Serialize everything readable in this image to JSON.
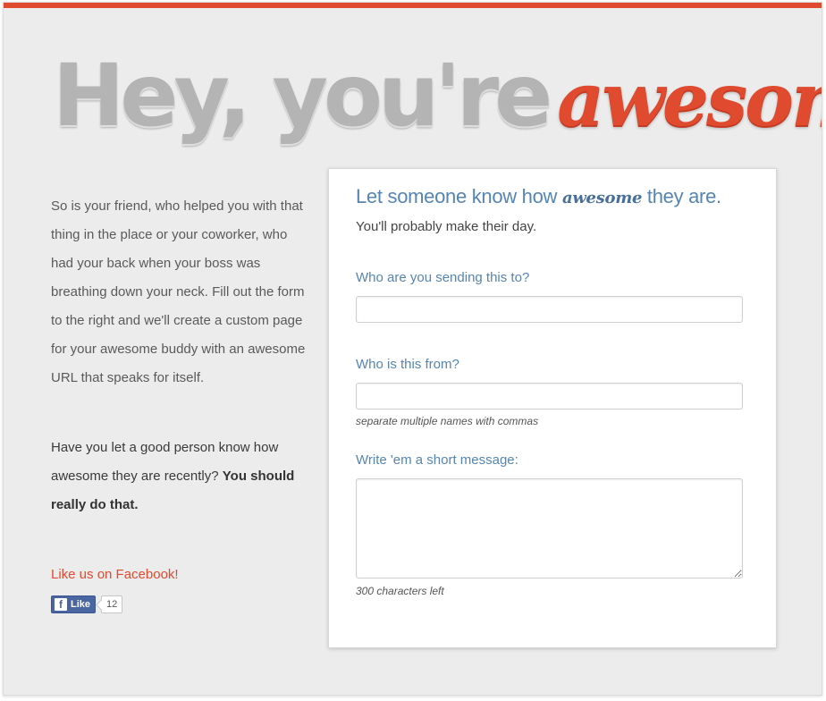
{
  "header": {
    "headline_plain": "Hey, you're",
    "headline_script": "awesome"
  },
  "intro": {
    "paragraph": "So is your friend, who helped you with that thing in the place or your coworker, who had your back when your boss was breathing down your neck. Fill out the form to the right and we'll create a custom page for your awesome buddy with an awesome URL that speaks for itself.",
    "question": "Have you let a good person know how awesome they are recently?",
    "question_bold": "You should really do that."
  },
  "social": {
    "facebook_link": "Like us on Facebook!",
    "like_logo": "f",
    "like_label": "Like",
    "like_count": "12"
  },
  "form": {
    "title_before": "Let someone know how",
    "title_script": "awesome",
    "title_after": "they are.",
    "subtitle": "You'll probably make their day.",
    "recipient_label": "Who are you sending this to?",
    "recipient_value": "",
    "sender_label": "Who is this from?",
    "sender_value": "",
    "sender_help": "separate multiple names with commas",
    "message_label": "Write 'em a short message:",
    "message_value": "",
    "chars_left": "300 characters left"
  },
  "colors": {
    "accent": "#e04a2f",
    "link_blue": "#5585b5",
    "background": "#ececec",
    "facebook_blue": "#4a66a0"
  },
  "icons": [
    "facebook-icon",
    "resize-handle-icon"
  ]
}
